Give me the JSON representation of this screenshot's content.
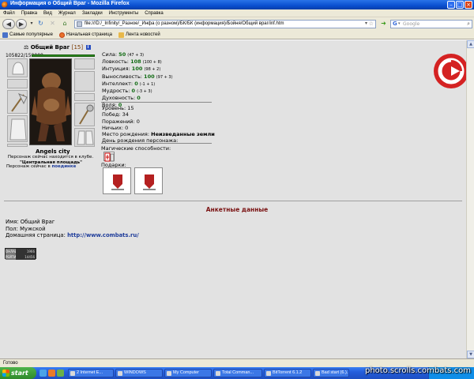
{
  "window": {
    "title": "Информация о Общий Враг - Mozilla Firefox"
  },
  "menu": [
    "Файл",
    "Правка",
    "Вид",
    "Журнал",
    "Закладки",
    "Инструменты",
    "Справка"
  ],
  "nav": {
    "url": "file:///D:/_Infinity/_Разное/_Инфа (о разном)/БК/БК (информация)/Бойня/Общий враг/inf.htm",
    "search_placeholder": "Google"
  },
  "bookmarks": [
    "Самые популярные",
    "Начальная страница",
    "Лента новостей"
  ],
  "character": {
    "name": "Общий Враг",
    "level": "[15]",
    "hp": "105822/150000",
    "city": "Angels city",
    "club_text": "Персонаж сейчас находится в клубе.",
    "location": "\"Центральная площадь\"",
    "now_label": "Персонаж сейчас в",
    "now_value": "поединке"
  },
  "stats": [
    {
      "label": "Сила:",
      "value": "50",
      "extra": "(47 + 3)"
    },
    {
      "label": "Ловкость:",
      "value": "108",
      "extra": "(100 + 8)"
    },
    {
      "label": "Интуиция:",
      "value": "100",
      "extra": "(98 + 2)"
    },
    {
      "label": "Выносливость:",
      "value": "100",
      "extra": "(97 + 3)"
    },
    {
      "label": "Интеллект:",
      "value": "0",
      "extra": "(-1 + 1)"
    },
    {
      "label": "Мудрость:",
      "value": "0",
      "extra": "(-3 + 3)"
    },
    {
      "label": "Духовность:",
      "value": "0",
      "extra": ""
    },
    {
      "label": "Воля:",
      "value": "0",
      "extra": ""
    }
  ],
  "info": {
    "level_label": "Уровень:",
    "level": "15",
    "wins_label": "Побед:",
    "wins": "34",
    "losses_label": "Поражений:",
    "losses": "0",
    "draws_label": "Ничьих:",
    "draws": "0",
    "birthplace_label": "Место рождения:",
    "birthplace": "Неизведанные земли",
    "birthday_label": "День рождения персонажа:"
  },
  "magic_label": "Магические способности:",
  "gifts_label": "Подарки:",
  "profile": {
    "title": "Анкетные данные",
    "name_label": "Имя:",
    "name": "Общий Враг",
    "sex_label": "Пол:",
    "sex": "Мужской",
    "home_label": "Домашняя страница:",
    "home": "http://www.combats.ru/"
  },
  "counter": {
    "r1a": "ОНЛАЙН",
    "r1b": "1966",
    "r2a": "РЕЙТИНГ",
    "r2b": "14456"
  },
  "status": "Готово",
  "taskbar": {
    "start": "start",
    "buttons": [
      "2 Internet E...",
      "WINDOWS",
      "My Computer",
      "Total Comman...",
      "BitTorrent 6.1.2",
      "Bad start (6.)..."
    ]
  },
  "watermark": "photo.scrolls.combats.com",
  "colors": {
    "stat_value": "#0f6a12",
    "profile_title": "#7a1212",
    "link": "#1e3c9a"
  }
}
